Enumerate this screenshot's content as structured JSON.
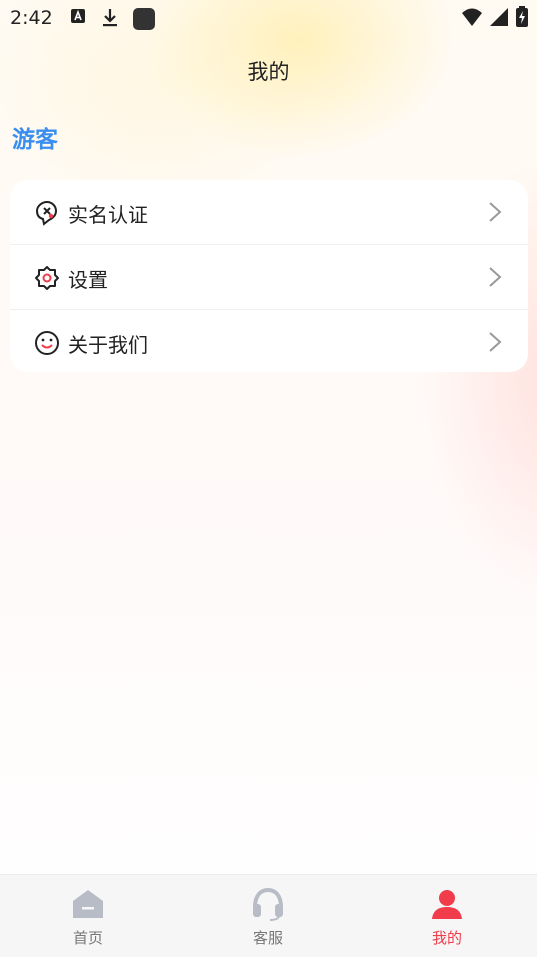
{
  "status_bar": {
    "time": "2:42",
    "icons": [
      "font-icon",
      "download-icon",
      "app-square-icon",
      "wifi-icon",
      "signal-icon",
      "battery-charging-icon"
    ]
  },
  "header": {
    "title": "我的"
  },
  "user": {
    "name": "游客"
  },
  "menu": {
    "items": [
      {
        "label": "实名认证",
        "icon": "real-name-verification-icon"
      },
      {
        "label": "设置",
        "icon": "gear-icon"
      },
      {
        "label": "关于我们",
        "icon": "smiley-icon"
      }
    ]
  },
  "tab_bar": {
    "items": [
      {
        "label": "首页",
        "icon": "home-icon",
        "active": false
      },
      {
        "label": "客服",
        "icon": "headset-icon",
        "active": false
      },
      {
        "label": "我的",
        "icon": "person-icon",
        "active": true
      }
    ]
  },
  "colors": {
    "accent_blue": "#3a8ef0",
    "active_red": "#f03c4b",
    "inactive_gray": "#b8bcc6",
    "tab_label_gray": "#777777"
  }
}
